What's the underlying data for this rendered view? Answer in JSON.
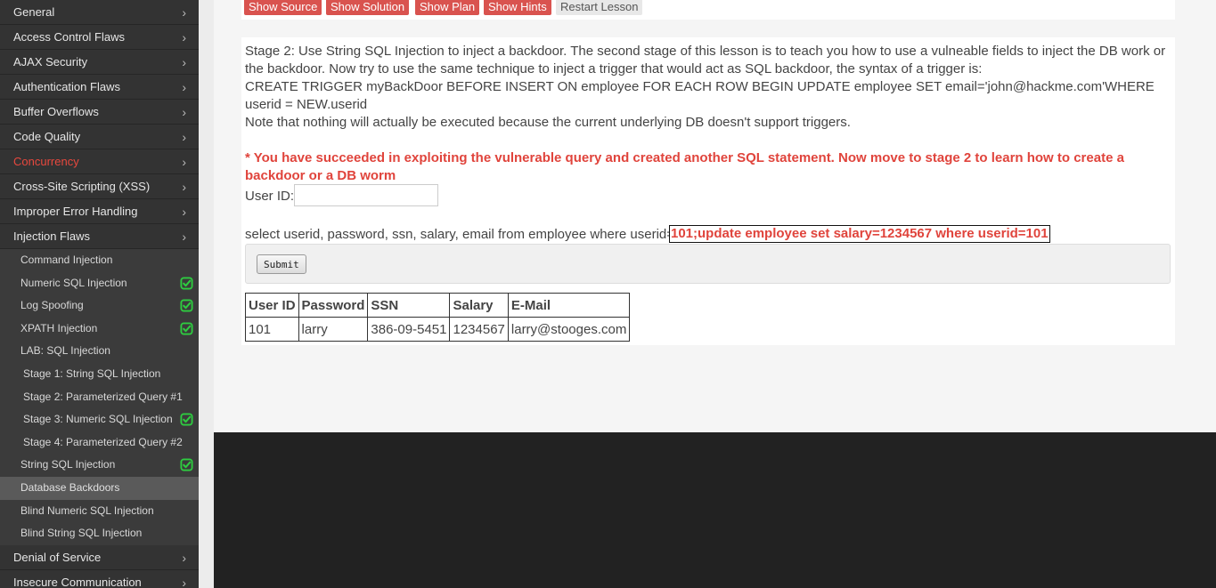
{
  "sidebar": {
    "categories_top": [
      {
        "label": "General"
      },
      {
        "label": "Access Control Flaws"
      },
      {
        "label": "AJAX Security"
      },
      {
        "label": "Authentication Flaws"
      },
      {
        "label": "Buffer Overflows"
      },
      {
        "label": "Code Quality"
      },
      {
        "label": "Concurrency",
        "highlight": true
      },
      {
        "label": "Cross-Site Scripting (XSS)"
      },
      {
        "label": "Improper Error Handling"
      },
      {
        "label": "Injection Flaws"
      }
    ],
    "injection_items": [
      {
        "label": "Command Injection",
        "level": 1,
        "done": false
      },
      {
        "label": "Numeric SQL Injection",
        "level": 1,
        "done": true
      },
      {
        "label": "Log Spoofing",
        "level": 1,
        "done": true
      },
      {
        "label": "XPATH Injection",
        "level": 1,
        "done": true
      },
      {
        "label": "LAB: SQL Injection",
        "level": 1,
        "done": false
      },
      {
        "label": "Stage 1: String SQL Injection",
        "level": 2,
        "done": false
      },
      {
        "label": "Stage 2: Parameterized Query #1",
        "level": 2,
        "done": false
      },
      {
        "label": "Stage 3: Numeric SQL Injection",
        "level": 2,
        "done": true
      },
      {
        "label": "Stage 4: Parameterized Query #2",
        "level": 2,
        "done": false
      },
      {
        "label": "String SQL Injection",
        "level": 1,
        "done": true
      },
      {
        "label": "Database Backdoors",
        "level": 1,
        "done": false,
        "active": true
      },
      {
        "label": "Blind Numeric SQL Injection",
        "level": 1,
        "done": false
      },
      {
        "label": "Blind String SQL Injection",
        "level": 1,
        "done": false
      }
    ],
    "categories_bottom": [
      {
        "label": "Denial of Service"
      },
      {
        "label": "Insecure Communication"
      }
    ],
    "chevron": "›",
    "check_icon": "check-circle-icon",
    "check_color": "#2ecc40"
  },
  "toolbar": {
    "show_source": "Show Source",
    "show_solution": "Show Solution",
    "show_plan": "Show Plan",
    "show_hints": "Show Hints",
    "restart": "Restart Lesson"
  },
  "lesson": {
    "stage_text_1": "Stage 2: Use String SQL Injection to inject a backdoor. The second stage of this lesson is to teach you how to use a vulneable fields to inject the DB work or the backdoor. Now try to use the same technique to inject a trigger that would act as SQL backdoor, the syntax of a trigger is:",
    "trigger_text": "CREATE TRIGGER myBackDoor BEFORE INSERT ON employee FOR EACH ROW BEGIN UPDATE employee SET email='john@hackme.com'WHERE userid = NEW.userid",
    "note_text": "Note that nothing will actually be executed because the current underlying DB doesn't support triggers.",
    "success_text": "* You have succeeded in exploiting the vulnerable query and created another SQL statement. Now move to stage 2 to learn how to create a backdoor or a DB worm",
    "userid_label": "User ID:",
    "userid_value": "",
    "query_prefix": "select userid, password, ssn, salary, email from employee where userid=",
    "query_injected": "101;update employee set salary=1234567 where userid=101",
    "submit_label": "Submit"
  },
  "results": {
    "headers": [
      "User ID",
      "Password",
      "SSN",
      "Salary",
      "E-Mail"
    ],
    "rows": [
      [
        "101",
        "larry",
        "386-09-5451",
        "1234567",
        "larry@stooges.com"
      ]
    ]
  }
}
